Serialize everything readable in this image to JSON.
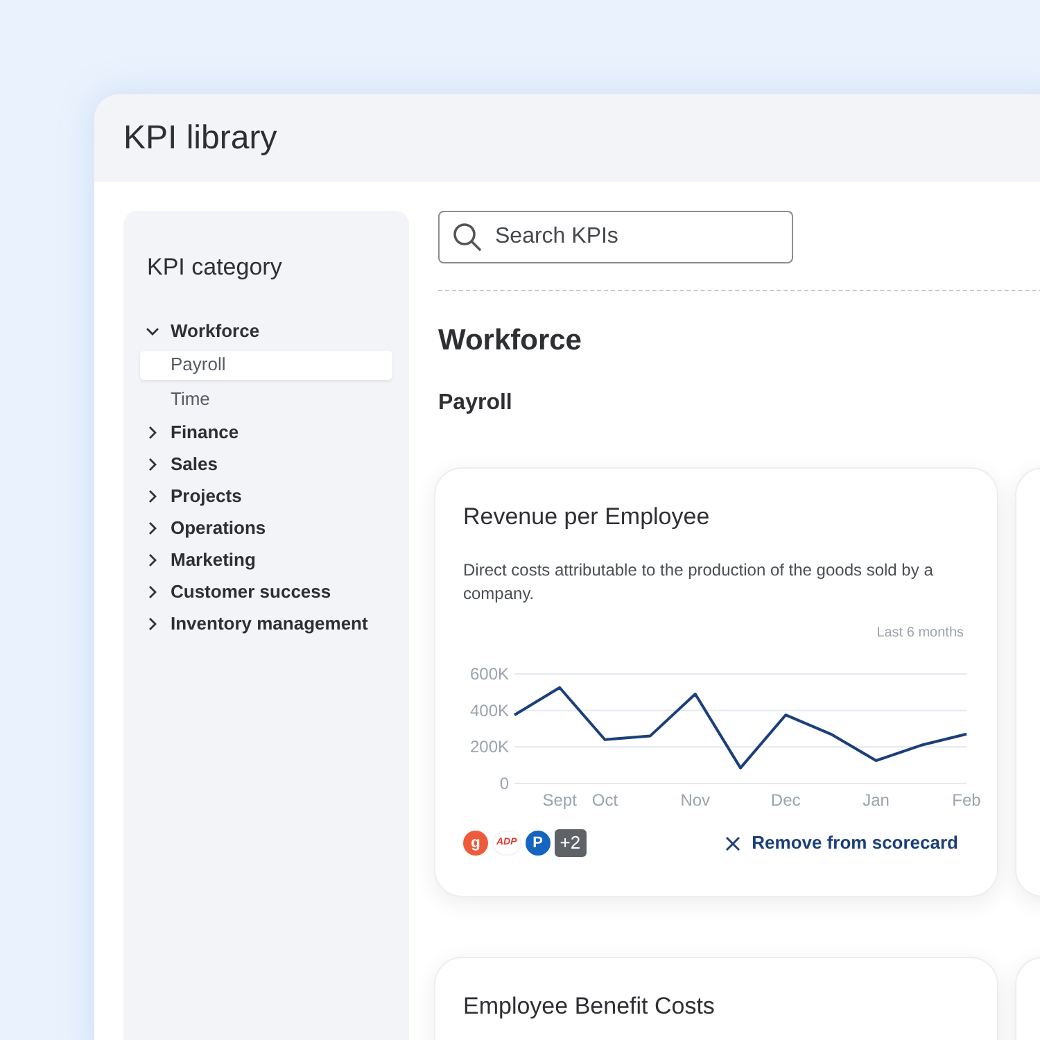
{
  "window": {
    "title": "KPI library"
  },
  "sidebar": {
    "title": "KPI category",
    "items": [
      {
        "label": "Workforce",
        "expanded": true,
        "selected": false,
        "children": [
          {
            "label": "Payroll",
            "selected": true
          },
          {
            "label": "Time",
            "selected": false
          }
        ]
      },
      {
        "label": "Finance",
        "expanded": false,
        "selected": false
      },
      {
        "label": "Sales",
        "expanded": false,
        "selected": false
      },
      {
        "label": "Projects",
        "expanded": false,
        "selected": false
      },
      {
        "label": "Operations",
        "expanded": false,
        "selected": false
      },
      {
        "label": "Marketing",
        "expanded": false,
        "selected": false
      },
      {
        "label": "Customer success",
        "expanded": false,
        "selected": false
      },
      {
        "label": "Inventory management",
        "expanded": false,
        "selected": false
      }
    ]
  },
  "search": {
    "placeholder": "Search KPIs"
  },
  "section": {
    "title": "Workforce",
    "subtitle": "Payroll"
  },
  "cards": [
    {
      "title": "Revenue per Employee",
      "description": "Direct costs attributable to the production of the goods sold by a company.",
      "period": "Last 6 months",
      "chart_data": {
        "type": "line",
        "categories": [
          null,
          "Sept",
          "Oct",
          null,
          "Nov",
          null,
          "Dec",
          null,
          "Jan",
          null,
          "Feb"
        ],
        "series": [
          {
            "color": "#1b3f7a",
            "values": [
              375000,
              525000,
              240000,
              260000,
              490000,
              85000,
              375000,
              270000,
              125000,
              210000,
              270000
            ]
          }
        ],
        "ylim": [
          0,
          600000
        ],
        "yticks": [
          {
            "value": 0,
            "label": "0"
          },
          {
            "value": 200000,
            "label": "200K"
          },
          {
            "value": 400000,
            "label": "400K"
          },
          {
            "value": 600000,
            "label": "600K"
          }
        ]
      },
      "sources": [
        {
          "kind": "circle",
          "label": "g",
          "color": "#ee5a3c"
        },
        {
          "kind": "wordmark",
          "label": "ADP",
          "color": "#e8332a"
        },
        {
          "kind": "circle",
          "label": "P",
          "color": "#1565c0"
        },
        {
          "kind": "count",
          "label": "+2",
          "color": "#5f6368"
        }
      ],
      "action": "Remove from scorecard"
    },
    {
      "title": "Employee Benefit Costs"
    }
  ]
}
